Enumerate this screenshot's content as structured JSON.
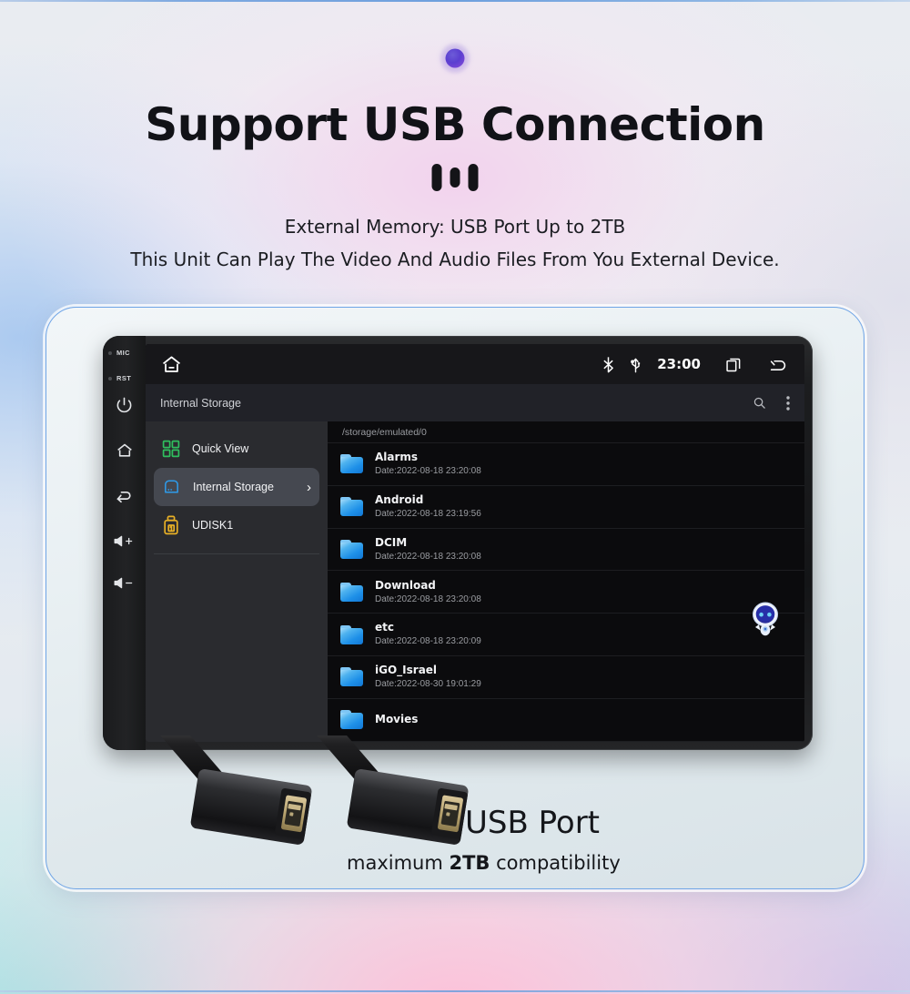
{
  "page": {
    "title": "Support USB Connection",
    "subtitle_1": "External Memory: USB Port Up to 2TB",
    "subtitle_2": "This Unit Can Play The Video And Audio Files From You External Device.",
    "accent_blue": "#6ea4e6",
    "dot_purple": "#5b3fd0"
  },
  "usb_caption": {
    "title": "USB Port",
    "sub_prefix": "maximum ",
    "sub_strong": "2TB",
    "sub_suffix": " compatibility"
  },
  "device": {
    "side_buttons": [
      {
        "name": "mic-indicator",
        "label": "MIC"
      },
      {
        "name": "reset-indicator",
        "label": "RST"
      },
      {
        "name": "power-button",
        "icon": "power-icon"
      },
      {
        "name": "home-button",
        "icon": "home-icon"
      },
      {
        "name": "back-button",
        "icon": "back-icon"
      },
      {
        "name": "volume-up-button",
        "icon": "volume-up-icon"
      },
      {
        "name": "volume-down-button",
        "icon": "volume-down-icon"
      }
    ]
  },
  "statusbar": {
    "home_icon": "home-minus-icon",
    "bluetooth_icon": "bluetooth-icon",
    "usb_icon": "usb-icon",
    "clock": "23:00",
    "recents_icon": "recents-icon",
    "back_icon": "back-arrow-icon"
  },
  "toolbar": {
    "title": "Internal Storage",
    "search_icon": "search-icon",
    "overflow_icon": "more-vertical-icon"
  },
  "sidebar": {
    "items": [
      {
        "label": "Quick View",
        "icon": "grid-icon",
        "color": "#2fbf5e",
        "selected": false,
        "chevron": ""
      },
      {
        "label": "Internal Storage",
        "icon": "storage-icon",
        "color": "#2e9bea",
        "selected": true,
        "chevron": "›"
      },
      {
        "label": "UDISK1",
        "icon": "usb-drive-icon",
        "color": "#e8b026",
        "selected": false,
        "chevron": ""
      }
    ]
  },
  "files": {
    "path": "/storage/emulated/0",
    "rows": [
      {
        "name": "Alarms",
        "date": "Date:2022-08-18 23:20:08"
      },
      {
        "name": "Android",
        "date": "Date:2022-08-18 23:19:56"
      },
      {
        "name": "DCIM",
        "date": "Date:2022-08-18 23:20:08"
      },
      {
        "name": "Download",
        "date": "Date:2022-08-18 23:20:08"
      },
      {
        "name": "etc",
        "date": "Date:2022-08-18 23:20:09"
      },
      {
        "name": "iGO_Israel",
        "date": "Date:2022-08-30 19:01:29"
      },
      {
        "name": "Movies",
        "date": ""
      }
    ]
  },
  "mascot": {
    "name": "robot-assistant-icon"
  }
}
